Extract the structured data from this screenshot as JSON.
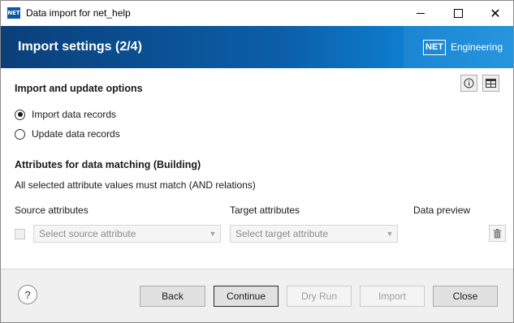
{
  "window": {
    "icon_text": "NET",
    "title": "Data import for net_help",
    "controls": {
      "minimize": "minimize",
      "maximize": "maximize",
      "close": "close"
    }
  },
  "banner": {
    "title": "Import settings (2/4)",
    "logo_box": "NET",
    "logo_text": "Engineering"
  },
  "options": {
    "heading": "Import and update options",
    "radios": [
      {
        "label": "Import data records",
        "checked": true
      },
      {
        "label": "Update data records",
        "checked": false
      }
    ]
  },
  "matching": {
    "heading": "Attributes for data matching (Building)",
    "description": "All selected attribute values must match (AND relations)",
    "columns": {
      "source": "Source attributes",
      "target": "Target attributes",
      "preview": "Data preview"
    },
    "row": {
      "source_placeholder": "Select source attribute",
      "target_placeholder": "Select target attribute"
    }
  },
  "footer": {
    "help": "?",
    "buttons": {
      "back": "Back",
      "continue": "Continue",
      "dry_run": "Dry Run",
      "import": "Import",
      "close": "Close"
    }
  },
  "icons": {
    "info": "info-icon",
    "table": "table-icon",
    "trash": "trash-icon",
    "help": "help-icon"
  }
}
